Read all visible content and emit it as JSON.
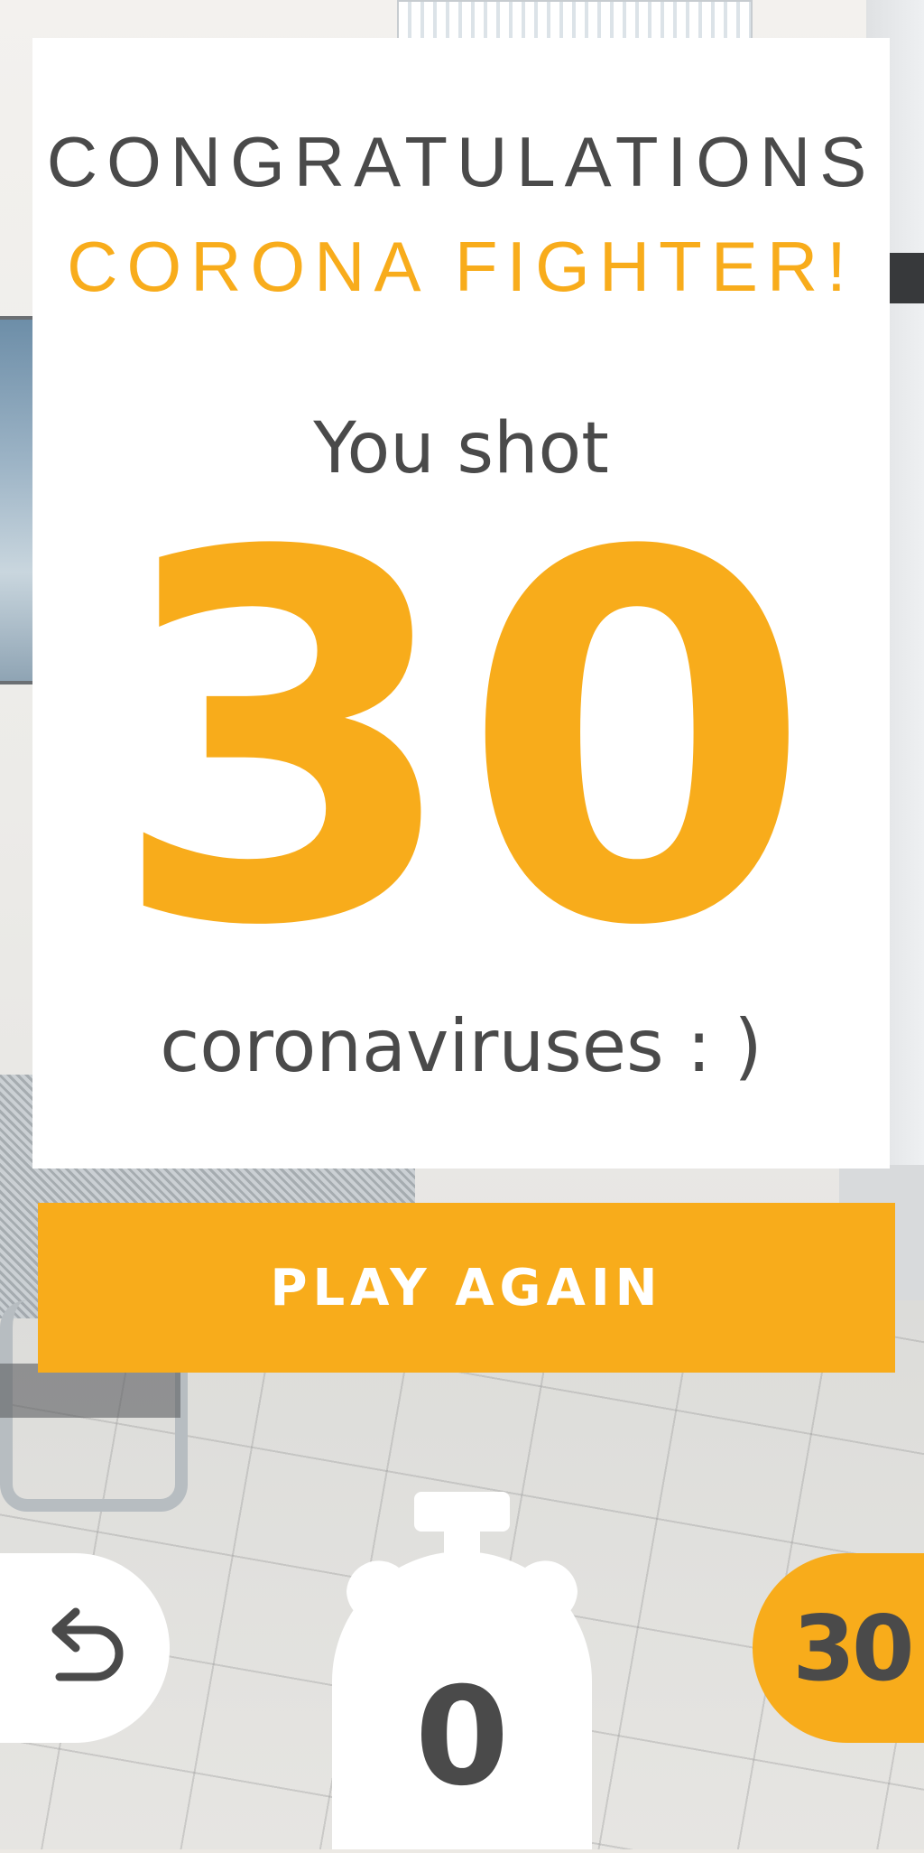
{
  "result": {
    "title_line1": "CONGRATULATIONS",
    "title_line2": "CORONA FIGHTER!",
    "intro": "You shot",
    "score": "30",
    "outro": "coronaviruses : )"
  },
  "actions": {
    "play_again_label": "PLAY AGAIN"
  },
  "hud": {
    "back_icon": "undo-arrow-icon",
    "timer_icon": "stopwatch-icon",
    "timer_value": "0",
    "score_value": "30"
  },
  "colors": {
    "accent": "#f8ac1b",
    "text_dark": "#4a4a4a",
    "card_bg": "#ffffff"
  }
}
